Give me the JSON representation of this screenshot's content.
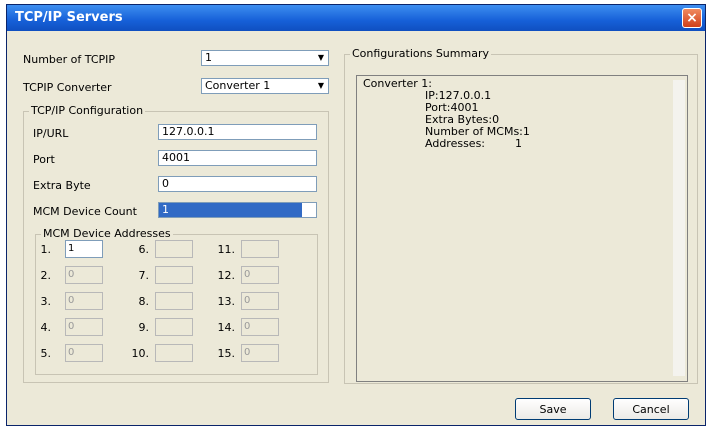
{
  "window": {
    "title": "TCP/IP Servers",
    "close": "×"
  },
  "left": {
    "num_tcpip_label": "Number of TCPIP",
    "num_tcpip_value": "1",
    "converter_label": "TCPIP Converter",
    "converter_value": "Converter 1",
    "config_group_label": "TCP/IP Configuration",
    "ip_label": "IP/URL",
    "ip_value": "127.0.0.1",
    "port_label": "Port",
    "port_value": "4001",
    "extra_label": "Extra Byte",
    "extra_value": "0",
    "mcm_count_label": "MCM Device Count",
    "mcm_count_value": "1",
    "addr_group_label": "MCM Device Addresses",
    "addresses": [
      {
        "num": "1.",
        "value": "1"
      },
      {
        "num": "2.",
        "value": "0"
      },
      {
        "num": "3.",
        "value": "0"
      },
      {
        "num": "4.",
        "value": "0"
      },
      {
        "num": "5.",
        "value": "0"
      },
      {
        "num": "6.",
        "value": ""
      },
      {
        "num": "7.",
        "value": ""
      },
      {
        "num": "8.",
        "value": ""
      },
      {
        "num": "9.",
        "value": ""
      },
      {
        "num": "10.",
        "value": ""
      },
      {
        "num": "11.",
        "value": ""
      },
      {
        "num": "12.",
        "value": "0"
      },
      {
        "num": "13.",
        "value": "0"
      },
      {
        "num": "14.",
        "value": "0"
      },
      {
        "num": "15.",
        "value": "0"
      }
    ]
  },
  "right": {
    "summary_label": "Configurations Summary",
    "lines": [
      "Converter 1:",
      "IP:127.0.0.1",
      "Port:4001",
      "Extra Bytes:0",
      "Number of MCMs:1",
      "Addresses:",
      "1"
    ]
  },
  "buttons": {
    "save": "Save",
    "cancel": "Cancel"
  }
}
